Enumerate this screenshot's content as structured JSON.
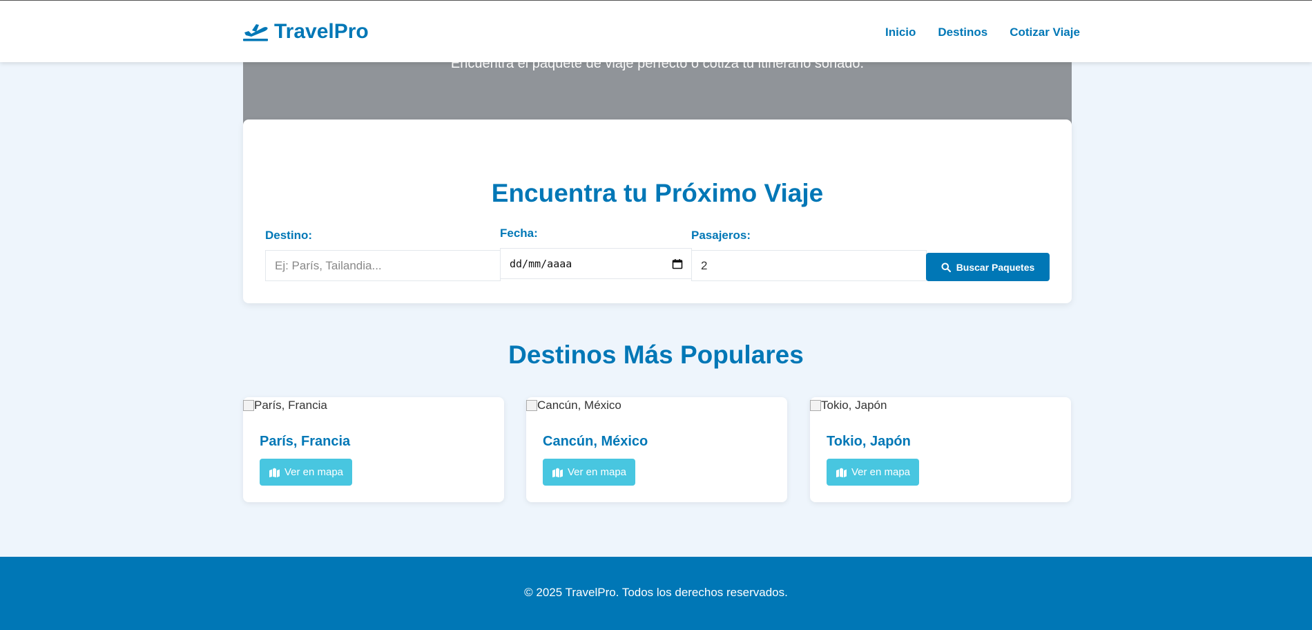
{
  "header": {
    "brand": "TravelPro",
    "brand_icon": "plane-departure-icon",
    "nav": [
      "Inicio",
      "Destinos",
      "Cotizar Viaje"
    ]
  },
  "hero": {
    "subtitle": "Encuentra el paquete de viaje perfecto o cotiza tu itinerario soñado."
  },
  "search": {
    "title": "Encuentra tu Próximo Viaje",
    "destination_label": "Destino:",
    "destination_placeholder": "Ej: París, Tailandia...",
    "date_label": "Fecha:",
    "date_value": "dd/mm/aaaa",
    "passengers_label": "Pasajeros:",
    "passengers_value": "2",
    "button_label": "Buscar Paquetes",
    "button_icon": "search-icon"
  },
  "popular": {
    "title": "Destinos Más Populares",
    "cards": [
      {
        "img_alt": "París, Francia",
        "title": "París, Francia",
        "button": "Ver en mapa"
      },
      {
        "img_alt": "Cancún, México",
        "title": "Cancún, México",
        "button": "Ver en mapa"
      },
      {
        "img_alt": "Tokio, Japón",
        "title": "Tokio, Japón",
        "button": "Ver en mapa"
      }
    ],
    "button_icon": "map-icon"
  },
  "footer": {
    "text": "© 2025 TravelPro. Todos los derechos reservados."
  },
  "colors": {
    "primary": "#0077b6",
    "accent": "#48c6e0",
    "background": "#eef5fc",
    "hero": "#909499"
  }
}
